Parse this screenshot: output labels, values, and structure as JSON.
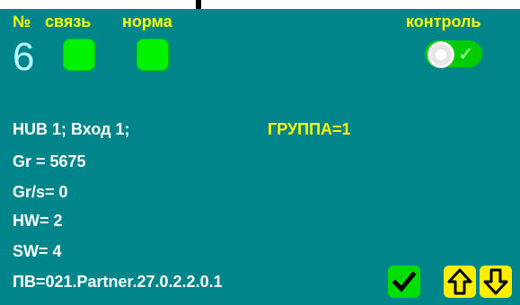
{
  "header": {
    "no_label": "№",
    "link_label": "связь",
    "norm_label": "норма",
    "control_label": "контроль"
  },
  "device_number": "6",
  "info": {
    "hub_line": "HUB   1; Вход  1;",
    "group_line": "ГРУППА=1",
    "gr_line": "Gr  =  5675",
    "grs_line": "Gr/s=       0",
    "hw_line": "HW=       2",
    "sw_line": "SW=       4",
    "fw_line": "ПВ=021.Partner.27.0.2.2.0.1"
  },
  "colors": {
    "background": "#00858a",
    "label": "#ffff00",
    "text": "#ffffff",
    "led_on": "#00f200",
    "confirm_button": "#00dd00",
    "nav_button": "#ffee00"
  },
  "icons": {
    "confirm": "check-icon",
    "up": "arrow-up-icon",
    "down": "arrow-down-icon",
    "toggle_knob": "toggle-knob-icon"
  },
  "states": {
    "link_ok": true,
    "norm_ok": true,
    "control_enabled": true
  }
}
